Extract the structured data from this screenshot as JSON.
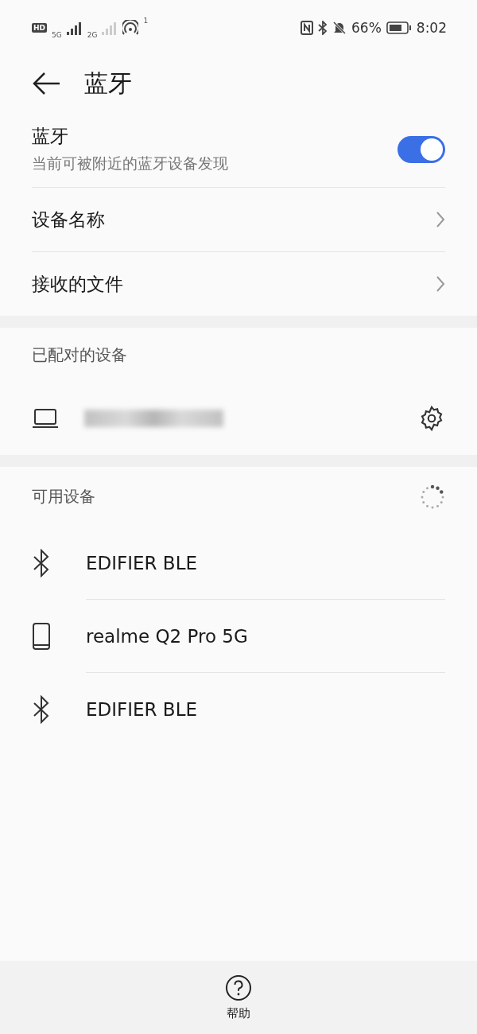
{
  "status_bar": {
    "hd": "HD",
    "sim1": "5G",
    "sim2": "2G",
    "hotspot_count": "1",
    "battery": "66%",
    "time": "8:02"
  },
  "header": {
    "title": "蓝牙"
  },
  "bluetooth": {
    "title": "蓝牙",
    "subtitle": "当前可被附近的蓝牙设备发现",
    "on": true
  },
  "settings": [
    {
      "label": "设备名称"
    },
    {
      "label": "接收的文件"
    }
  ],
  "paired": {
    "title": "已配对的设备",
    "devices": [
      {
        "kind": "laptop"
      }
    ]
  },
  "available": {
    "title": "可用设备",
    "devices": [
      {
        "kind": "bluetooth",
        "name": "EDIFIER BLE"
      },
      {
        "kind": "phone",
        "name": "realme Q2 Pro 5G"
      },
      {
        "kind": "bluetooth",
        "name": "EDIFIER BLE"
      }
    ]
  },
  "footer": {
    "help": "帮助"
  }
}
